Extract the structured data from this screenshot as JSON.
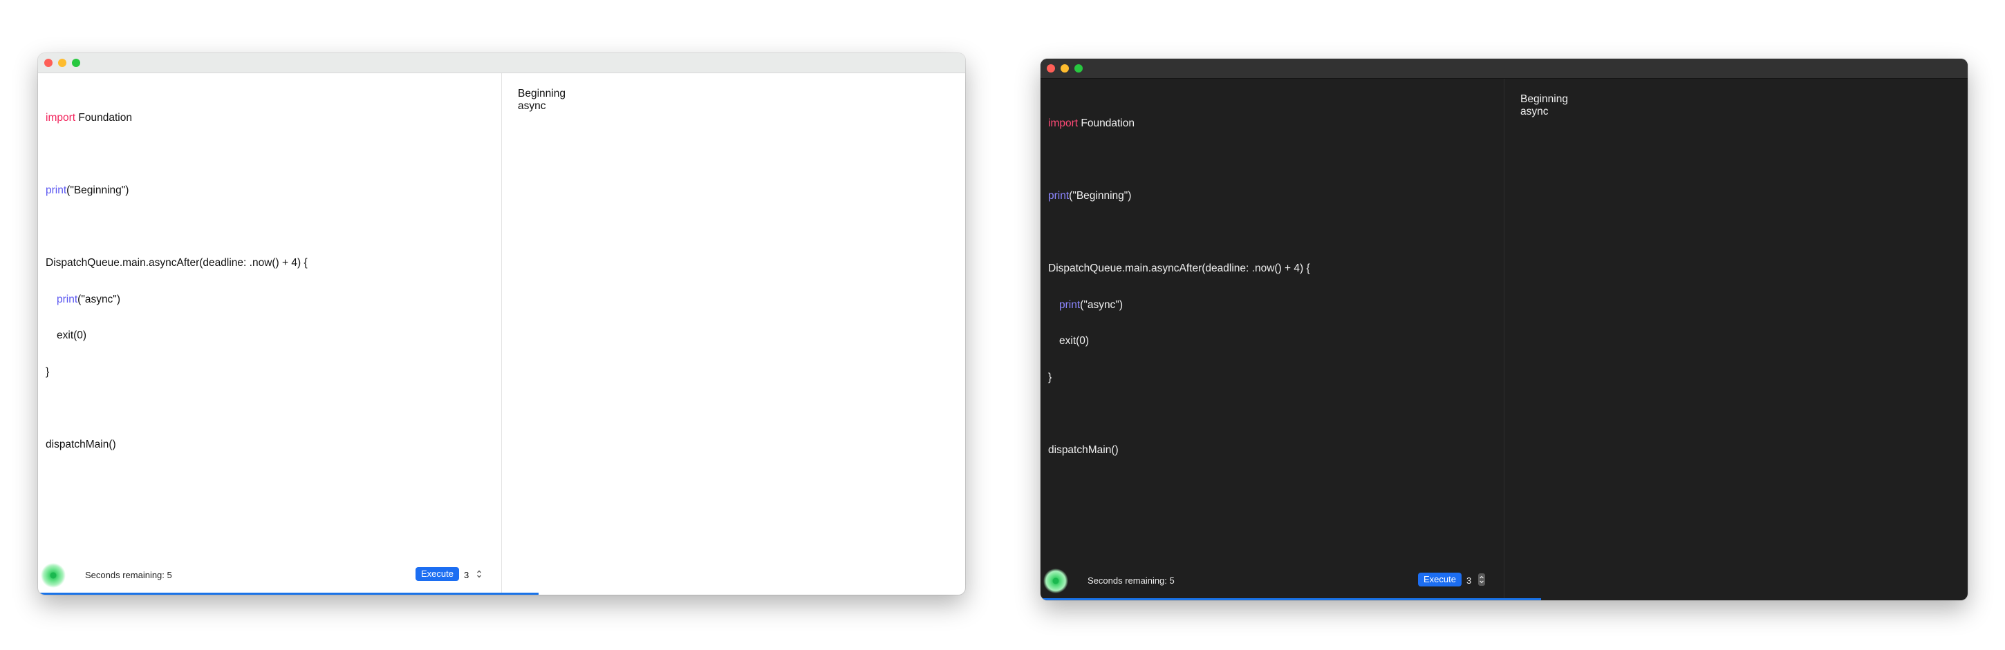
{
  "windows": [
    {
      "theme": "light",
      "editor": {
        "lines": {
          "l1_kw": "import",
          "l1_rest": " Foundation",
          "l3_fn": "print",
          "l3_rest": "(\"Beginning\")",
          "l5": "DispatchQueue.main.asyncAfter(deadline: .now() + 4) {",
          "l6_fn": "print",
          "l6_rest": "(\"async\")",
          "l7": "exit(0)",
          "l8": "}",
          "l10": "dispatchMain()"
        }
      },
      "output": {
        "lines": [
          "Beginning",
          "async"
        ]
      },
      "bottom": {
        "seconds_label": "Seconds remaining: 5",
        "execute_label": "Execute",
        "stepper_value": "3"
      },
      "progress": 0.54
    },
    {
      "theme": "dark",
      "editor": {
        "lines": {
          "l1_kw": "import",
          "l1_rest": " Foundation",
          "l3_fn": "print",
          "l3_rest": "(\"Beginning\")",
          "l5": "DispatchQueue.main.asyncAfter(deadline: .now() + 4) {",
          "l6_fn": "print",
          "l6_rest": "(\"async\")",
          "l7": "exit(0)",
          "l8": "}",
          "l10": "dispatchMain()"
        }
      },
      "output": {
        "lines": [
          "Beginning",
          "async"
        ]
      },
      "bottom": {
        "seconds_label": "Seconds remaining: 5",
        "execute_label": "Execute",
        "stepper_value": "3"
      },
      "progress": 0.54
    }
  ],
  "colors": {
    "accent": "#1c6ef2",
    "progress": "#1a73e8",
    "keyword": "#f2245c",
    "function": "#5b57f1",
    "status_green": "#28c840"
  }
}
